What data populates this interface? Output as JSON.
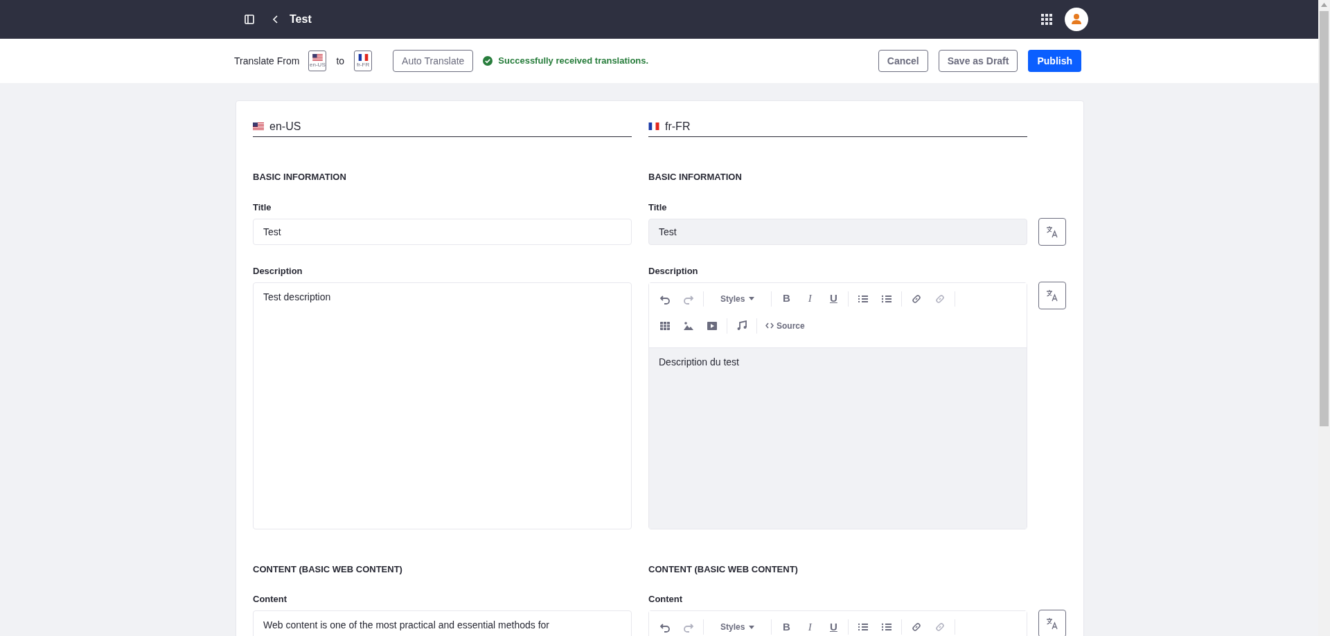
{
  "header": {
    "title": "Test"
  },
  "translate_bar": {
    "from_label": "Translate From",
    "from_locale": {
      "kind": "us",
      "code": "en-US"
    },
    "to_label": "to",
    "to_locale": {
      "kind": "fr",
      "code": "fr-FR"
    },
    "auto_translate": "Auto Translate",
    "status": "Successfully received translations.",
    "cancel": "Cancel",
    "save_draft": "Save as Draft",
    "publish": "Publish"
  },
  "columns": [
    {
      "locale": {
        "kind": "us",
        "code": "en-US"
      },
      "sections": [
        {
          "heading": "BASIC INFORMATION",
          "fields": [
            {
              "label": "Title",
              "kind": "text",
              "readonly": false,
              "value": "Test"
            },
            {
              "label": "Description",
              "kind": "textarea",
              "readonly": false,
              "value": "Test description"
            }
          ]
        },
        {
          "heading": "CONTENT (BASIC WEB CONTENT)",
          "fields": [
            {
              "label": "Content",
              "kind": "textarea",
              "readonly": false,
              "value": "Web content is one of the most practical and essential methods for"
            }
          ]
        }
      ]
    },
    {
      "locale": {
        "kind": "fr",
        "code": "fr-FR"
      },
      "sections": [
        {
          "heading": "BASIC INFORMATION",
          "fields": [
            {
              "label": "Title",
              "kind": "text",
              "readonly": true,
              "translatable": true,
              "value": "Test"
            },
            {
              "label": "Description",
              "kind": "rich",
              "readonly": true,
              "translatable": true,
              "value": "Description du test",
              "toolbar_rows": [
                [
                  {
                    "kind": "undo",
                    "disabled": false
                  },
                  {
                    "kind": "redo",
                    "disabled": true
                  },
                  {
                    "kind": "separator"
                  },
                  {
                    "kind": "styles",
                    "label": "Styles",
                    "disabled": false
                  },
                  {
                    "kind": "separator"
                  },
                  {
                    "kind": "bold",
                    "label": "B",
                    "disabled": false
                  },
                  {
                    "kind": "italic",
                    "label": "I",
                    "disabled": false
                  },
                  {
                    "kind": "underline",
                    "label": "U",
                    "disabled": false
                  },
                  {
                    "kind": "separator"
                  },
                  {
                    "kind": "ordered_list",
                    "disabled": false
                  },
                  {
                    "kind": "bullet_list",
                    "disabled": false
                  },
                  {
                    "kind": "separator"
                  },
                  {
                    "kind": "link",
                    "disabled": false
                  },
                  {
                    "kind": "unlink",
                    "disabled": true
                  },
                  {
                    "kind": "separator"
                  }
                ],
                [
                  {
                    "kind": "table",
                    "disabled": false
                  },
                  {
                    "kind": "image",
                    "disabled": false
                  },
                  {
                    "kind": "video",
                    "disabled": false
                  },
                  {
                    "kind": "separator"
                  },
                  {
                    "kind": "audio",
                    "disabled": false
                  },
                  {
                    "kind": "separator"
                  },
                  {
                    "kind": "source",
                    "label": "Source",
                    "disabled": false
                  }
                ]
              ]
            }
          ]
        },
        {
          "heading": "CONTENT (BASIC WEB CONTENT)",
          "fields": [
            {
              "label": "Content",
              "kind": "rich",
              "translatable": true,
              "toolbar_rows": [
                [
                  {
                    "kind": "undo",
                    "disabled": false
                  },
                  {
                    "kind": "redo",
                    "disabled": true
                  },
                  {
                    "kind": "separator"
                  },
                  {
                    "kind": "styles",
                    "label": "Styles",
                    "disabled": false
                  },
                  {
                    "kind": "separator"
                  },
                  {
                    "kind": "bold",
                    "label": "B",
                    "disabled": false
                  },
                  {
                    "kind": "italic",
                    "label": "I",
                    "disabled": false
                  },
                  {
                    "kind": "underline",
                    "label": "U",
                    "disabled": false
                  },
                  {
                    "kind": "separator"
                  },
                  {
                    "kind": "ordered_list",
                    "disabled": false
                  },
                  {
                    "kind": "bullet_list",
                    "disabled": false
                  },
                  {
                    "kind": "separator"
                  },
                  {
                    "kind": "link",
                    "disabled": false
                  },
                  {
                    "kind": "unlink",
                    "disabled": true
                  },
                  {
                    "kind": "separator"
                  }
                ]
              ]
            }
          ]
        }
      ]
    }
  ]
}
